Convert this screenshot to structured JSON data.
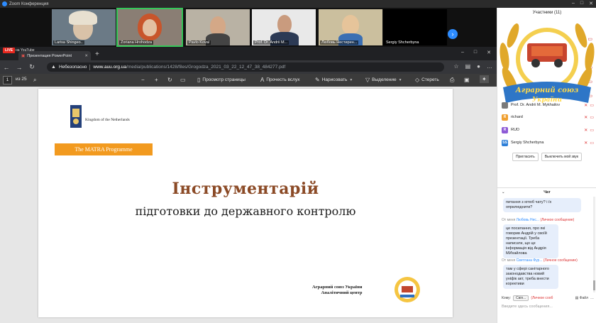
{
  "zoom": {
    "title": "Zoom Конференция"
  },
  "video_strip": {
    "tiles": [
      {
        "name": "Larisa Shingeo.."
      },
      {
        "name": "Zoriana Hrohodza"
      },
      {
        "name": "Pavlo Koval"
      },
      {
        "name": "Prof. Dr. Andrii M..."
      },
      {
        "name": "Любовь Нестирен..."
      },
      {
        "name": "Sergiy Shcherbyna"
      }
    ]
  },
  "browser": {
    "live_label": "LIVE",
    "youtube_label": "на YouTube",
    "tab_title": "Презентация PowerPoint",
    "insecure_label": "Небезопасно",
    "url_host": "www.auu.org.ua",
    "url_path": "/media/publications/1428/files/Grogodza_2021_03_22_12_47_38_484277.pdf"
  },
  "pdf_toolbar": {
    "page_current": "1",
    "page_total": "из 25",
    "view_label": "Просмотр страницы",
    "read_aloud": "Прочесть вслух",
    "draw_label": "Нарисовать",
    "highlight_label": "Выделение",
    "erase_label": "Стереть"
  },
  "slide": {
    "kingdom": "Kingdom of the Netherlands",
    "matra": "The MATRA Programme",
    "title": "Інструментарій",
    "subtitle": "підготовки до державного контролю",
    "org_line1": "Аграрний союз України",
    "org_line2": "Аналітичний центр"
  },
  "panel": {
    "participants_label": "Участники",
    "participants_count": "(11)",
    "wreath_text_1": "Аграрний союз",
    "wreath_text_2": "України",
    "participants": [
      {
        "name": "Prof. Dr. Andrii M. Mykhailov",
        "initials": "",
        "color": "#7a7a7a"
      },
      {
        "name": "richard",
        "initials": "R",
        "color": "#f0a030"
      },
      {
        "name": "RUD",
        "initials": "R",
        "color": "#8e5bd6"
      },
      {
        "name": "Sergiy Shcherbyna",
        "initials": "SS",
        "color": "#2d7fd8"
      }
    ],
    "invite_btn": "Пригласить",
    "mute_all_btn": "Выключить мой звук",
    "chat_label": "Чат",
    "chat": {
      "msg1": "питання з ютюб чату? і їх оприлюднити?",
      "from2_prefix": "От меня",
      "from2_name": "Любовь Нес...",
      "from2_private": "(Личное сообщение)",
      "msg2": "це посилання, про які говорив Андрій у своїй презентації. Треба написати, що це інформація від Андрія МИхайлова",
      "from3_prefix": "От меня",
      "from3_name": "Светлана Фур...",
      "from3_private": "(Личное сообщение)",
      "msg3": "там у сфері санітарного законодавства новий уніфік акт, треба внести корективи"
    },
    "to_label": "Кому:",
    "to_value": "Свіп...",
    "to_private": "(Личное сооб",
    "file_label": "Файл",
    "input_placeholder": "Введите здесь сообщения..."
  }
}
